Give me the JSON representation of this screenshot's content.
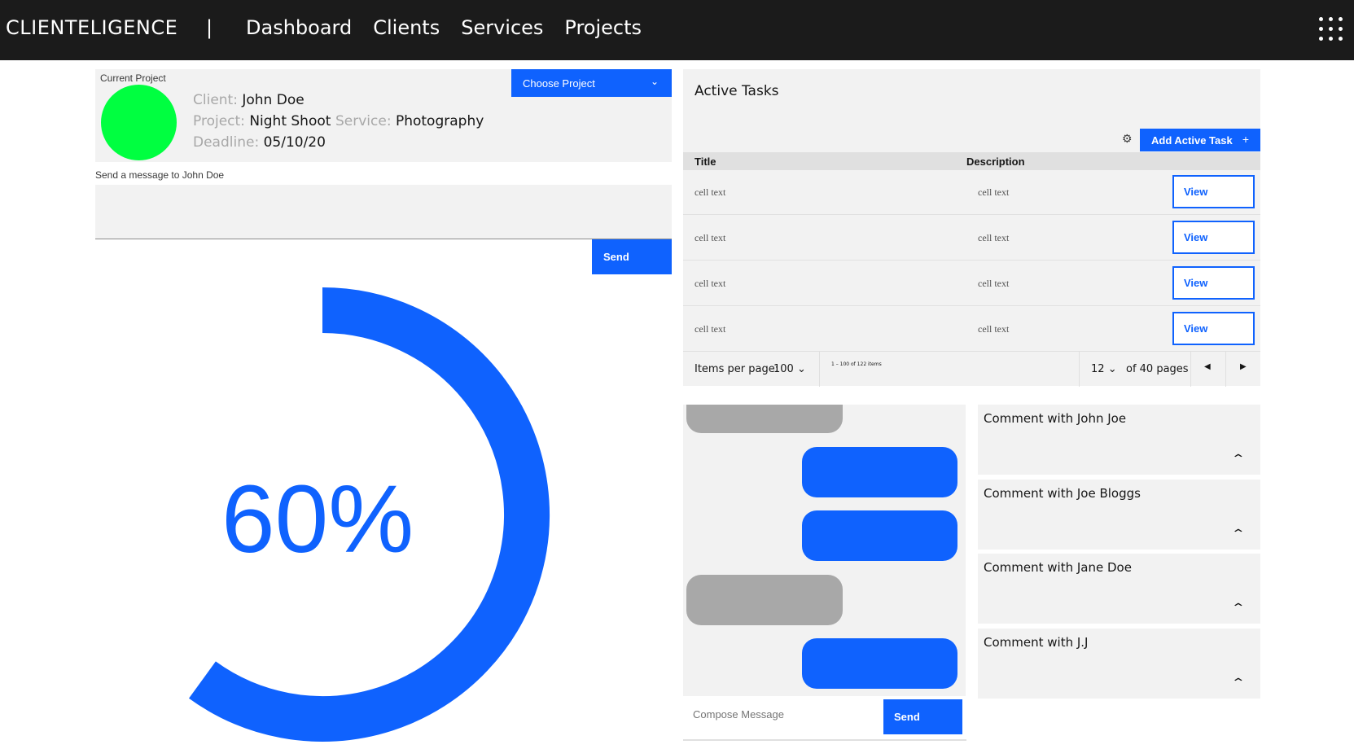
{
  "nav": {
    "brand": "CLIENTELIGENCE",
    "separator": "|",
    "links": [
      "Dashboard",
      "Clients",
      "Services",
      "Projects"
    ],
    "app_switcher_icon": "app-switcher-grid-icon"
  },
  "project": {
    "caption": "Current Project",
    "status_color": "#00ff40",
    "client_key": "Client:",
    "client": "John Doe",
    "project_key": "Project:",
    "project": "Night Shoot",
    "service_key": "Service:",
    "service": "Photography",
    "deadline_key": "Deadline:",
    "deadline": "05/10/20",
    "choose_label": "Choose Project"
  },
  "message": {
    "label": "Send a message to John Doe",
    "value": "",
    "send_label": "Send"
  },
  "progress": {
    "label": "60%",
    "value": 60
  },
  "tasks": {
    "title": "Active Tasks",
    "add_label": "Add Active Task",
    "columns": [
      "Title",
      "Description"
    ],
    "rows": [
      {
        "title": "cell text",
        "description": "cell text",
        "action": "View"
      },
      {
        "title": "cell text",
        "description": "cell text",
        "action": "View"
      },
      {
        "title": "cell text",
        "description": "cell text",
        "action": "View"
      },
      {
        "title": "cell text",
        "description": "cell text",
        "action": "View"
      }
    ],
    "pagination": {
      "items_per_page_label": "Items per page:",
      "items_per_page": "100",
      "range_text": "1 – 100 of 122 items",
      "page": "12",
      "of_pages": "of 40 pages"
    }
  },
  "chat": {
    "compose_placeholder": "Compose Message",
    "send_label": "Send",
    "bubbles": [
      "incoming",
      "outgoing",
      "outgoing",
      "incoming",
      "outgoing"
    ]
  },
  "comments": [
    {
      "title": "Comment with John Joe"
    },
    {
      "title": "Comment with Joe Bloggs"
    },
    {
      "title": "Comment with Jane Doe"
    },
    {
      "title": "Comment with J.J"
    }
  ],
  "colors": {
    "accent": "#0f62fe",
    "nav_bg": "#1b1b1b",
    "panel_bg": "#f2f2f2",
    "incoming_bubble": "#a8a8a8"
  }
}
